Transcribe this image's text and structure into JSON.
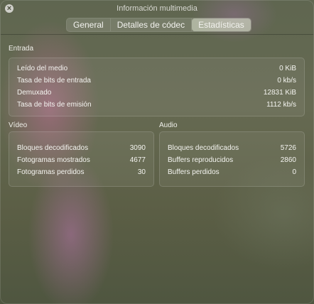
{
  "window": {
    "title": "Información multimedia",
    "close_glyph": "×"
  },
  "tabs": [
    {
      "label": "General",
      "active": false
    },
    {
      "label": "Detalles de códec",
      "active": false
    },
    {
      "label": "Estadísticas",
      "active": true
    }
  ],
  "entrada": {
    "title": "Entrada",
    "rows": [
      {
        "label": "Leído del medio",
        "value": "0 KiB"
      },
      {
        "label": "Tasa de bits de entrada",
        "value": "0 kb/s"
      },
      {
        "label": "Demuxado",
        "value": "12831 KiB"
      },
      {
        "label": "Tasa de bits de emisión",
        "value": "1112 kb/s"
      }
    ]
  },
  "video": {
    "title": "Vídeo",
    "rows": [
      {
        "label": "Bloques decodificados",
        "value": "3090"
      },
      {
        "label": "Fotogramas mostrados",
        "value": "4677"
      },
      {
        "label": "Fotogramas perdidos",
        "value": "30"
      }
    ]
  },
  "audio": {
    "title": "Audio",
    "rows": [
      {
        "label": "Bloques decodificados",
        "value": "5726"
      },
      {
        "label": "Buffers reproducidos",
        "value": "2860"
      },
      {
        "label": "Buffers perdidos",
        "value": "0"
      }
    ]
  }
}
